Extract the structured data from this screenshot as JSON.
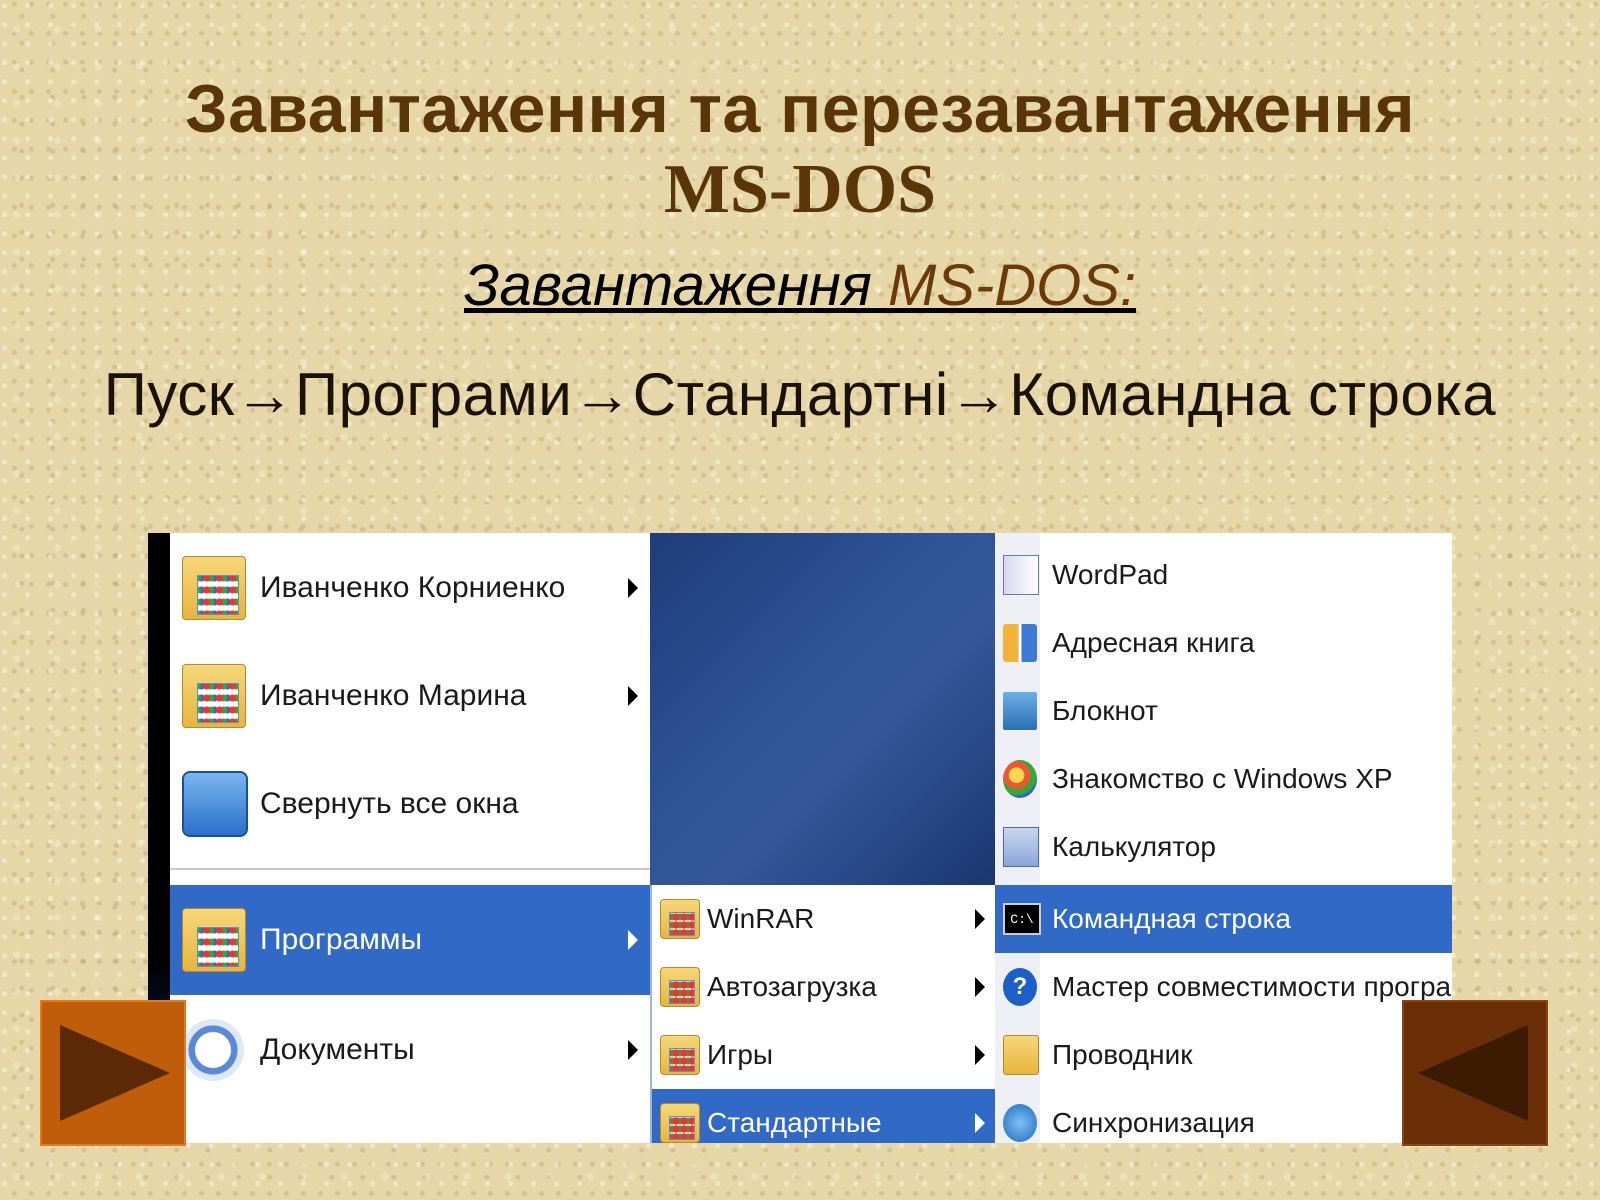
{
  "slide": {
    "title_line1": "Завантаження та перезавантаження",
    "title_line2": "MS-DOS",
    "subtitle_part1": "Завантаження ",
    "subtitle_part2": "MS-DOS:",
    "path": "Пуск→Програми→Стандартні→Командна строка"
  },
  "menu": {
    "col1": [
      {
        "label": "Иванченко Корниенко",
        "icon": "folder-icon",
        "submenu": true
      },
      {
        "label": "Иванченко Марина",
        "icon": "folder-icon",
        "submenu": true
      },
      {
        "label": "Свернуть все окна",
        "icon": "minimize-windows-icon",
        "submenu": false
      },
      {
        "label": "Программы",
        "icon": "programs-folder-icon",
        "submenu": true,
        "selected": true
      },
      {
        "label": "Документы",
        "icon": "documents-icon",
        "submenu": true
      }
    ],
    "col2": [
      {
        "label": "WinRAR",
        "icon": "folder-icon",
        "submenu": true
      },
      {
        "label": "Автозагрузка",
        "icon": "folder-icon",
        "submenu": true
      },
      {
        "label": "Игры",
        "icon": "folder-icon",
        "submenu": true
      },
      {
        "label": "Стандартные",
        "icon": "folder-icon",
        "submenu": true,
        "selected": true
      }
    ],
    "col3": [
      {
        "label": "WordPad",
        "icon": "wordpad-icon"
      },
      {
        "label": "Адресная книга",
        "icon": "address-book-icon"
      },
      {
        "label": "Блокнот",
        "icon": "notepad-icon"
      },
      {
        "label": "Знакомство с Windows XP",
        "icon": "windows-tour-icon"
      },
      {
        "label": "Калькулятор",
        "icon": "calculator-icon"
      },
      {
        "label": "Командная строка",
        "icon": "command-prompt-icon",
        "icon_text": "C:\\",
        "selected": true
      },
      {
        "label": "Мастер совместимости программ",
        "icon": "help-icon",
        "icon_text": "?"
      },
      {
        "label": "Проводник",
        "icon": "explorer-icon"
      },
      {
        "label": "Синхронизация",
        "icon": "sync-icon"
      }
    ]
  },
  "nav": {
    "next_icon": "play-forward-icon",
    "prev_icon": "play-back-icon"
  },
  "colors": {
    "title": "#5a3508",
    "selection": "#3169c6",
    "nav_next": "#c05d0a",
    "nav_prev": "#6a2f06"
  }
}
